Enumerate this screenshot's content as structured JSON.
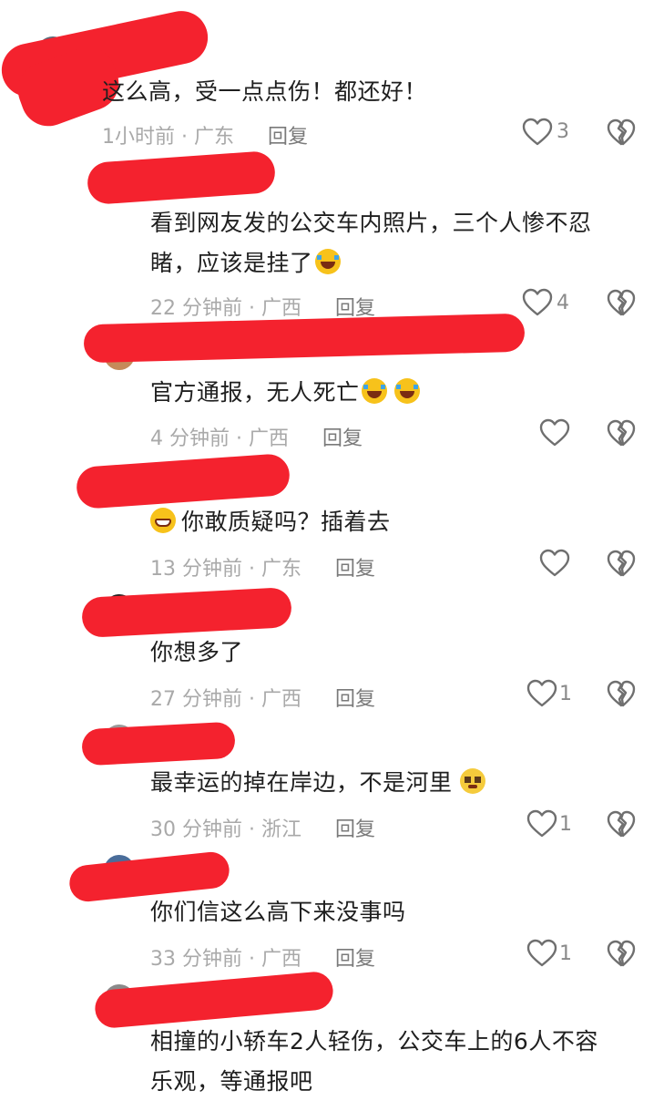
{
  "comments": [
    {
      "text": "这么高，受一点点伤！都还好！",
      "time": "1小时前",
      "region": "广东",
      "reply": "回复",
      "likes": "3"
    },
    {
      "text_line1": "看到网友发的公交车内照片，三个人惨不忍",
      "text_line2": "睹，应该是挂了",
      "time": "22 分钟前",
      "region": "广西",
      "reply": "回复",
      "likes": "4"
    },
    {
      "text": "官方通报，无人死亡",
      "time": "4 分钟前",
      "region": "广西",
      "reply": "回复",
      "likes": ""
    },
    {
      "text": "你敢质疑吗？插着去",
      "time": "13 分钟前",
      "region": "广东",
      "reply": "回复",
      "likes": ""
    },
    {
      "text": "你想多了",
      "time": "27 分钟前",
      "region": "广西",
      "reply": "回复",
      "likes": "1"
    },
    {
      "text": "最幸运的掉在岸边，不是河里",
      "time": "30 分钟前",
      "region": "浙江",
      "reply": "回复",
      "likes": "1"
    },
    {
      "text": "你们信这么高下来没事吗",
      "time": "33 分钟前",
      "region": "广西",
      "reply": "回复",
      "likes": "1"
    },
    {
      "text_line1": "相撞的小轿车2人轻伤，公交车上的6人不容",
      "text_line2": "乐观，等通报吧"
    }
  ],
  "meta_separator": "·",
  "icons": {
    "like": "heart-outline-icon",
    "dislike": "broken-heart-icon",
    "emoji_cry": "crying-laughing-emoji",
    "emoji_grin": "grinning-sweat-emoji",
    "emoji_plead": "pleading-face-emoji"
  },
  "colors": {
    "redaction": "#f4222e",
    "meta": "#a9a9a9",
    "reply": "#7a7a7a",
    "text": "#1f1f1f"
  }
}
